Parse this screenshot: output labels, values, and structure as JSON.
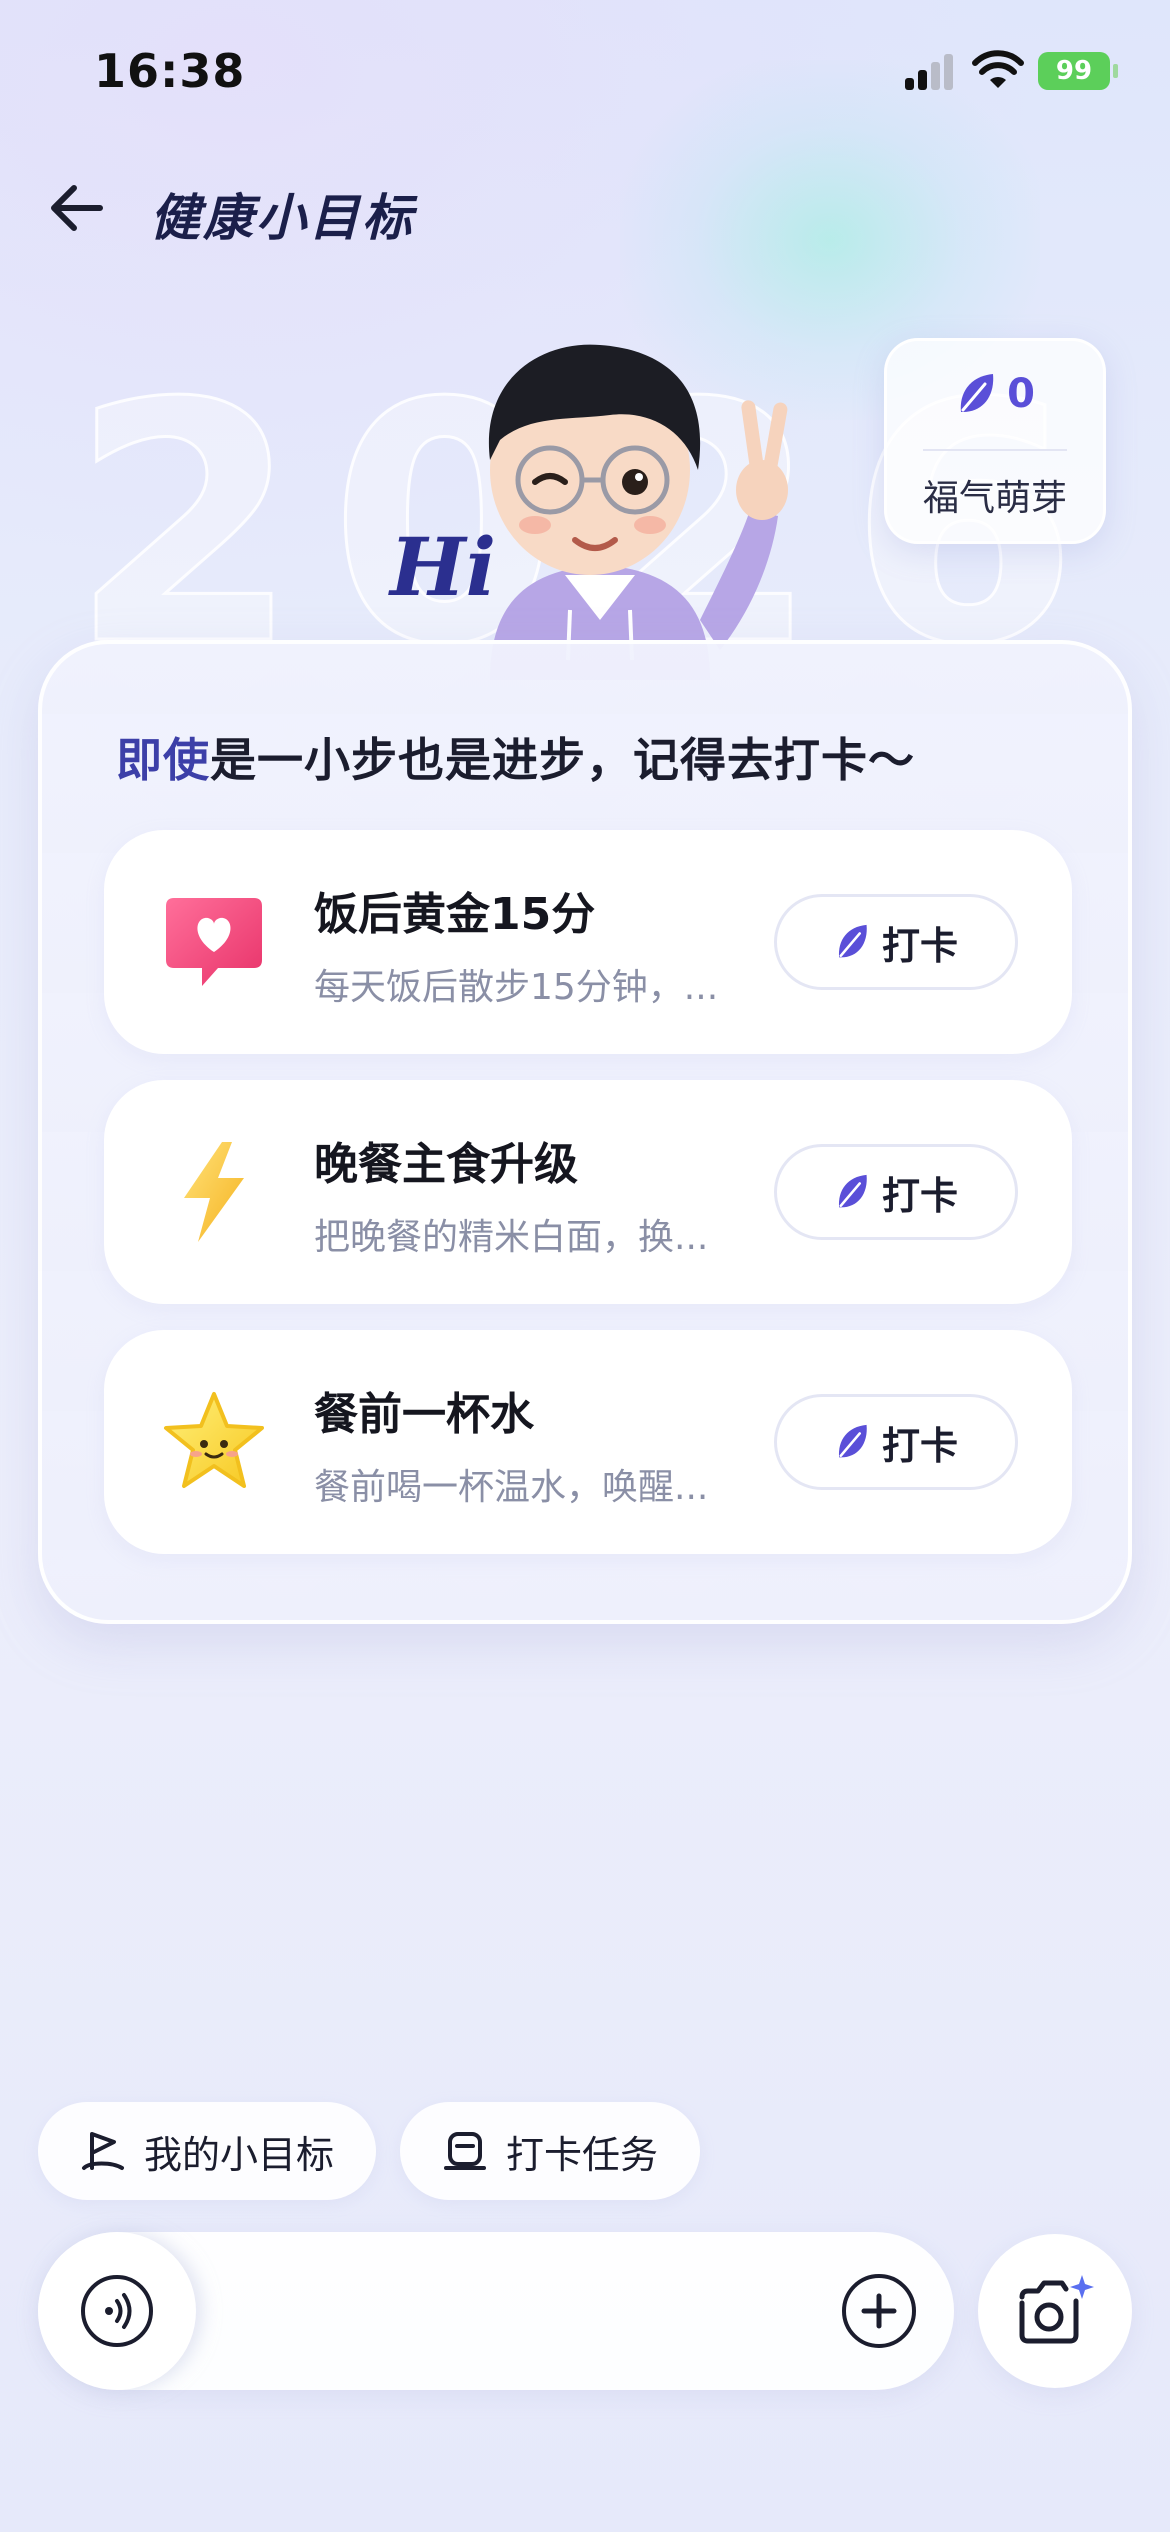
{
  "status_bar": {
    "time": "16:38",
    "battery": "99"
  },
  "header": {
    "title": "健康小目标"
  },
  "hero": {
    "year_watermark": "2026",
    "hi_logo": "Hi"
  },
  "points": {
    "value": "0",
    "label": "福气萌芽",
    "icon": "leaf-icon"
  },
  "panel": {
    "motto_accent": "即使",
    "motto_rest": "是一小步也是进步，记得去打卡～",
    "tasks": [
      {
        "title": "饭后黄金15分",
        "desc": "每天饭后散步15分钟，...",
        "button": "打卡",
        "icon": "heart-bubble-icon"
      },
      {
        "title": "晚餐主食升级",
        "desc": "把晚餐的精米白面，换...",
        "button": "打卡",
        "icon": "lightning-icon"
      },
      {
        "title": "餐前一杯水",
        "desc": "餐前喝一杯温水，唤醒...",
        "button": "打卡",
        "icon": "star-face-icon"
      }
    ]
  },
  "bottom": {
    "chips": [
      {
        "label": "我的小目标",
        "icon": "flag-icon"
      },
      {
        "label": "打卡任务",
        "icon": "task-icon"
      }
    ],
    "input": {
      "voice_icon": "voice-icon",
      "plus_icon": "plus-icon"
    },
    "camera_icon": "camera-icon"
  },
  "colors": {
    "accent": "#5a4fd8",
    "title": "#1b1f4a",
    "battery": "#5ccf5a"
  }
}
